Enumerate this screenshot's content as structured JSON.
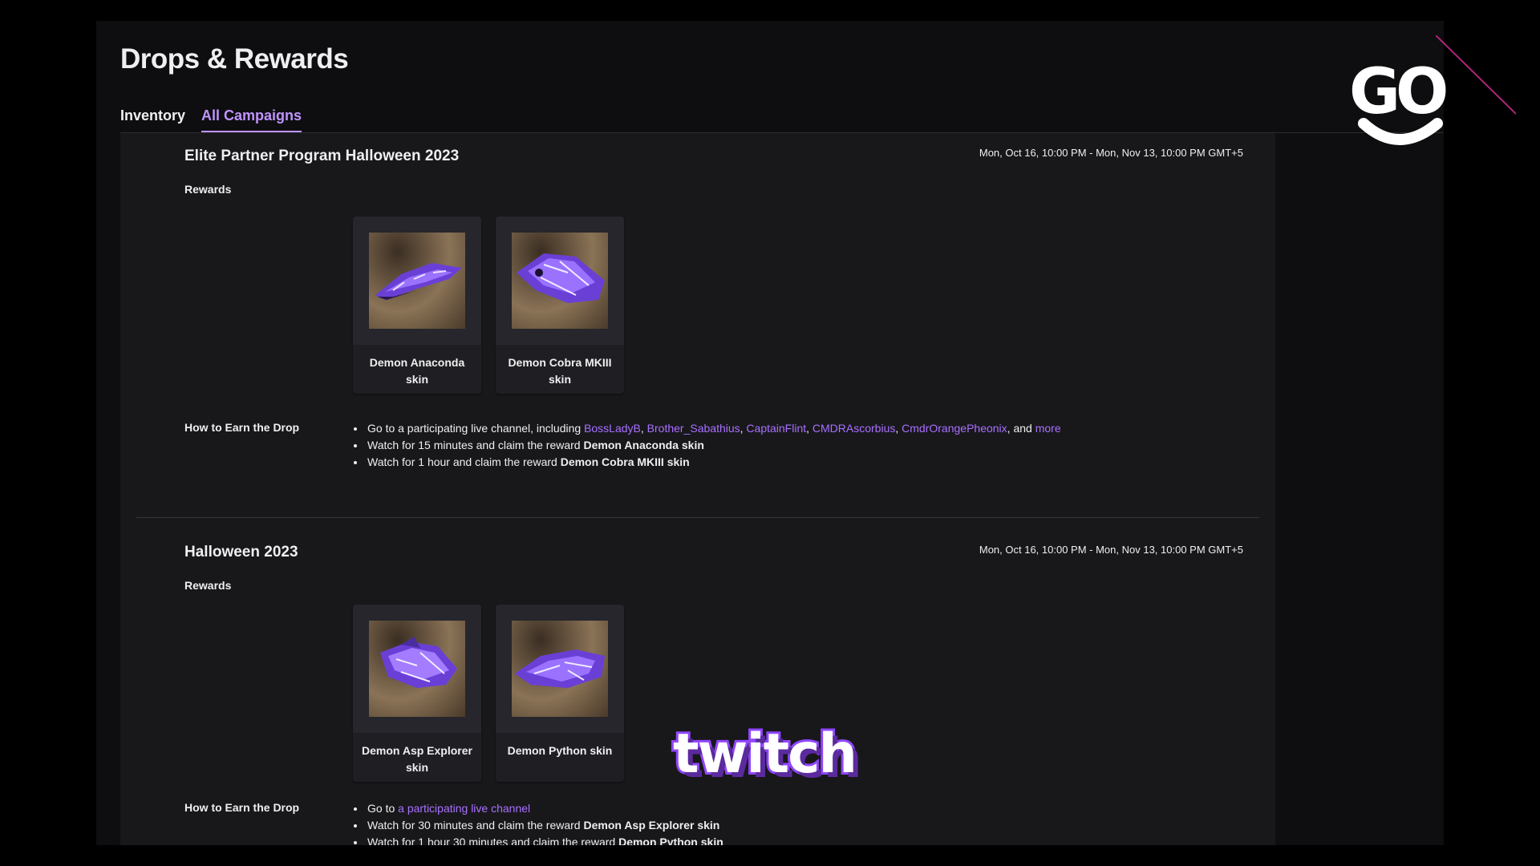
{
  "page": {
    "title": "Drops & Rewards",
    "tabs": [
      {
        "label": "Inventory",
        "active": false
      },
      {
        "label": "All Campaigns",
        "active": true
      }
    ]
  },
  "colors": {
    "accent": "#bf94ff",
    "link": "#a970ff",
    "background": "#0e0e10",
    "panel": "#18181b"
  },
  "campaigns": [
    {
      "title": "Elite Partner Program Halloween 2023",
      "dates": "Mon, Oct 16, 10:00 PM - Mon, Nov 13, 10:00 PM GMT+5",
      "rewards_label": "Rewards",
      "rewards": [
        {
          "name": "Demon Anaconda skin",
          "icon": "ship-skin-image"
        },
        {
          "name": "Demon Cobra MKIII skin",
          "icon": "ship-skin-image"
        }
      ],
      "howto_label": "How to Earn the Drop",
      "howto": {
        "line1_prefix": "Go to a participating live channel, including",
        "channels": [
          "BossLadyB",
          "Brother_Sabathius",
          "CaptainFlint",
          "CMDRAscorbius",
          "CmdrOrangePheonix"
        ],
        "sep": ",",
        "and": ", and",
        "more": "more",
        "line2_prefix": "Watch for 15 minutes and claim the reward",
        "line2_reward": "Demon Anaconda skin",
        "line3_prefix": "Watch for 1 hour and claim the reward",
        "line3_reward": "Demon Cobra MKIII skin"
      }
    },
    {
      "title": "Halloween 2023",
      "dates": "Mon, Oct 16, 10:00 PM - Mon, Nov 13, 10:00 PM GMT+5",
      "rewards_label": "Rewards",
      "rewards": [
        {
          "name": "Demon Asp Explorer skin",
          "icon": "ship-skin-image"
        },
        {
          "name": "Demon Python skin",
          "icon": "ship-skin-image"
        }
      ],
      "howto_label": "How to Earn the Drop",
      "howto": {
        "line1_prefix": "Go to",
        "line1_link": "a participating live channel",
        "line2_prefix": "Watch for 30 minutes and claim the reward",
        "line2_reward": "Demon Asp Explorer skin",
        "line3_prefix": "Watch for 1 hour 30 minutes and claim the reward",
        "line3_reward": "Demon Python skin"
      }
    }
  ],
  "overlays": {
    "go_logo_text": "GO",
    "twitch_logo_text": "twitch"
  }
}
